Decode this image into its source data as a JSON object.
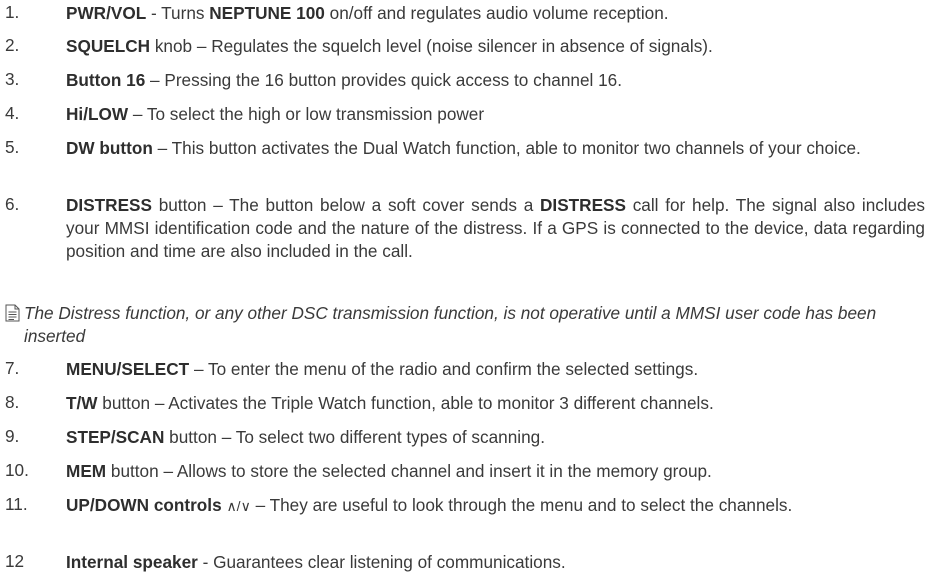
{
  "items": [
    {
      "num": "1.",
      "segments": [
        {
          "b": "PWR/VOL"
        },
        {
          "t": " - Turns "
        },
        {
          "b": "NEPTUNE 100"
        },
        {
          "t": " on/off and regulates audio volume reception."
        }
      ]
    },
    {
      "num": "2.",
      "segments": [
        {
          "b": "SQUELCH"
        },
        {
          "t": " knob – Regulates the squelch level (noise silencer in absence of signals)."
        }
      ]
    },
    {
      "num": "3.",
      "segments": [
        {
          "b": "Button 16"
        },
        {
          "t": "  – Pressing the 16 button provides quick access to channel 16."
        }
      ]
    },
    {
      "num": "4.",
      "segments": [
        {
          "b": "Hi/LOW"
        },
        {
          "t": " – To select the high or low transmission power"
        }
      ]
    },
    {
      "num": "5.",
      "segments": [
        {
          "b": "DW button"
        },
        {
          "t": " – This button activates the Dual Watch  function, able to monitor two channels of your choice."
        }
      ]
    },
    {
      "num": "6.",
      "segments": [
        {
          "b": "DISTRESS"
        },
        {
          "t": " button – The button below a soft cover sends a "
        },
        {
          "b": "DISTRESS"
        },
        {
          "t": " call for help. The signal also includes your MMSI identification code and the nature of the distress.  If a GPS is connected to the device, data regarding position and time are also included in the call."
        }
      ]
    },
    {
      "num": "7.",
      "segments": [
        {
          "b": "MENU/SELECT"
        },
        {
          "t": " – To enter the menu of the radio and confirm the selected settings."
        }
      ]
    },
    {
      "num": "8.",
      "segments": [
        {
          "b": "T/W"
        },
        {
          "t": " button – Activates the Triple Watch function, able to monitor 3 different channels."
        }
      ]
    },
    {
      "num": "9.",
      "segments": [
        {
          "b": "STEP/SCAN"
        },
        {
          "t": " button – To select two different types of scanning."
        }
      ]
    },
    {
      "num": "10.",
      "segments": [
        {
          "b": "MEM"
        },
        {
          "t": " button – Allows to store the selected channel and insert it in the memory group."
        }
      ]
    },
    {
      "num": "11.",
      "segments": [
        {
          "b": "UP/DOWN controls"
        },
        {
          "t": " "
        },
        {
          "a": "∧/∨"
        },
        {
          "t": " – They are useful to look through the menu and to select the channels."
        }
      ]
    },
    {
      "num": "12",
      "segments": [
        {
          "b": "Internal speaker"
        },
        {
          "t": " - Guarantees clear listening of communications."
        }
      ]
    }
  ],
  "note": {
    "icon": "note-icon",
    "text": "The Distress function, or any other DSC transmission function, is not operative until a MMSI user code has been inserted"
  }
}
